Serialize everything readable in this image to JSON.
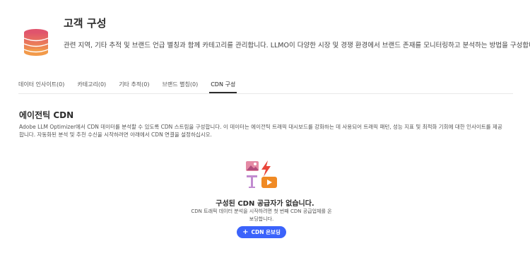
{
  "header": {
    "title": "고객 구성",
    "description": "관련 지역, 기타 추적 및 브랜드 언급 별칭과 함께 카테고리를 관리합니다. LLMO이 다양한 시장 및 경쟁 환경에서 브랜드 존재를 모니터링하고 분석하는 방법을 구성합니다."
  },
  "tabs": [
    {
      "label": "데이터 인사이트(0)"
    },
    {
      "label": "카테고리(0)"
    },
    {
      "label": "기타 추적(0)"
    },
    {
      "label": "브랜드 별칭(0)"
    },
    {
      "label": "CDN 구성"
    }
  ],
  "section": {
    "title": "에이전틱 CDN",
    "description": "Adobe LLM Optimizer에서 CDN 데이터를 분석할 수 있도록 CDN 스트림을 구성합니다. 이 데이터는 에이전틱 트래픽 대시보드를 강화하는 데 사용되어 트래픽 패턴, 성능 지표 및 최적화 기회에 대한 인사이트를 제공합니다. 자동화된 분석 및 추천 수신을 시작하려면 아래에서 CDN 연결을 설정하십시오."
  },
  "empty_state": {
    "title": "구성된 CDN 공급자가 없습니다.",
    "description": "CDN 트래픽 데이터 분석을 시작하려면 첫 번째 CDN 공급업체를 온보딩합니다.",
    "button_label": "CDN 온보딩",
    "button_icon": "plus-icon"
  },
  "colors": {
    "accent": "#3b63fb",
    "logo_top": "#e0546d",
    "logo_bottom": "#f29a4a"
  }
}
